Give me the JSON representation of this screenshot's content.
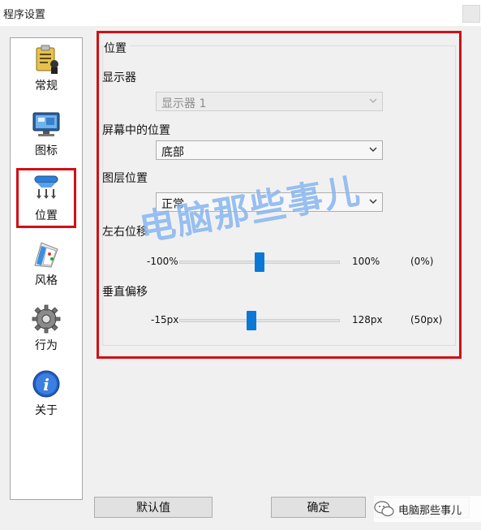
{
  "window": {
    "title": "程序设置"
  },
  "sidebar": {
    "items": [
      {
        "label": "常规",
        "icon": "clipboard-icon"
      },
      {
        "label": "图标",
        "icon": "monitor-icon"
      },
      {
        "label": "位置",
        "icon": "dock-position-icon",
        "selected": true
      },
      {
        "label": "风格",
        "icon": "style-icon"
      },
      {
        "label": "行为",
        "icon": "gear-icon"
      },
      {
        "label": "关于",
        "icon": "info-icon"
      }
    ]
  },
  "position_panel": {
    "group_title": "位置",
    "display_label": "显示器",
    "display_value": "显示器 1",
    "screen_position_label": "屏幕中的位置",
    "screen_position_value": "底部",
    "layer_label": "图层位置",
    "layer_value": "正常",
    "horizontal_offset": {
      "label": "左右位移",
      "min": "-100%",
      "max": "100%",
      "current": "(0%)",
      "value": 0.5
    },
    "vertical_offset": {
      "label": "垂直偏移",
      "min": "-15px",
      "max": "128px",
      "current": "(50px)",
      "value": 0.45
    }
  },
  "buttons": {
    "defaults": "默认值",
    "ok": "确定"
  },
  "watermark": {
    "text": "电脑那些事儿",
    "badge_text": "电脑那些事儿"
  },
  "colors": {
    "accent": "#0a78d4",
    "highlight": "#d20f14"
  }
}
